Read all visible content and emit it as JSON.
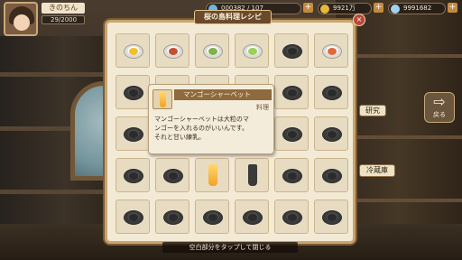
{
  "hud": {
    "player_name": "きのちん",
    "exp_text": "29/2000",
    "currency_1": "000382 / 107",
    "currency_2": "9921万",
    "currency_3": "9991682",
    "plus": "+"
  },
  "panel": {
    "title": "桜の島料理レシピ",
    "close": "×"
  },
  "tooltip": {
    "name": "マンゴーシャーベット",
    "category": "料理",
    "description": "マンゴーシャーベットは大粒のマ\nンゴーを入れるのがいいんです。\nそれと甘い練乳。"
  },
  "side": {
    "research": "研究",
    "back": "戻る",
    "fridge": "冷蔵庫",
    "back_arrow": "⇨"
  },
  "hint": "空白部分をタップして閉じる",
  "colors": {
    "panel_bg": "#f3ead6",
    "panel_border": "#c9a56c",
    "title_bg": "#6b4a2c"
  },
  "recipes": [
    {
      "state": "unlocked",
      "icon": "dish-lemon",
      "color": "#f2c02a"
    },
    {
      "state": "unlocked",
      "icon": "dish-meat",
      "color": "#c7502e"
    },
    {
      "state": "unlocked",
      "icon": "dish-green",
      "color": "#7fb24a"
    },
    {
      "state": "unlocked",
      "icon": "dish-salad",
      "color": "#9ccf5a"
    },
    {
      "state": "locked",
      "icon": "dish-locked"
    },
    {
      "state": "unlocked",
      "icon": "dish-shrimp",
      "color": "#e06a3a"
    },
    {
      "state": "locked",
      "icon": "dish-locked"
    },
    {
      "state": "locked",
      "icon": "dish-locked"
    },
    {
      "state": "locked",
      "icon": "dish-locked"
    },
    {
      "state": "locked",
      "icon": "dish-locked"
    },
    {
      "state": "locked",
      "icon": "dish-locked"
    },
    {
      "state": "locked",
      "icon": "dish-locked"
    },
    {
      "state": "locked",
      "icon": "dish-locked"
    },
    {
      "state": "locked",
      "icon": "dish-locked"
    },
    {
      "state": "locked",
      "icon": "dish-locked"
    },
    {
      "state": "locked",
      "icon": "dish-locked"
    },
    {
      "state": "locked",
      "icon": "dish-locked"
    },
    {
      "state": "locked",
      "icon": "dish-locked"
    },
    {
      "state": "locked",
      "icon": "dish-locked"
    },
    {
      "state": "locked",
      "icon": "dish-locked"
    },
    {
      "state": "unlocked",
      "icon": "glass-mango",
      "color": "#f2a228"
    },
    {
      "state": "locked",
      "icon": "glass-locked"
    },
    {
      "state": "locked",
      "icon": "dish-locked"
    },
    {
      "state": "locked",
      "icon": "dish-locked"
    },
    {
      "state": "locked",
      "icon": "dish-locked"
    },
    {
      "state": "locked",
      "icon": "dish-locked"
    },
    {
      "state": "locked",
      "icon": "dish-locked"
    },
    {
      "state": "locked",
      "icon": "dish-locked"
    },
    {
      "state": "locked",
      "icon": "dish-locked"
    },
    {
      "state": "locked",
      "icon": "dish-locked"
    }
  ]
}
